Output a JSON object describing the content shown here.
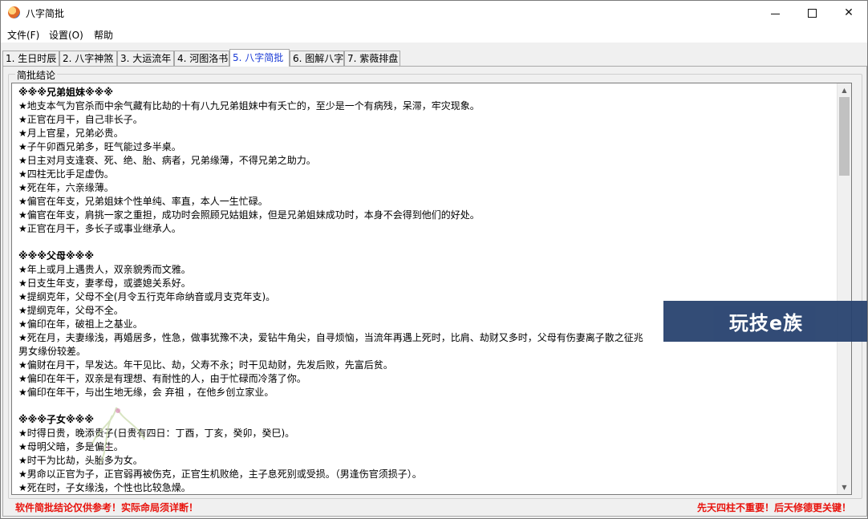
{
  "window": {
    "title": "八字简批"
  },
  "menu": [
    {
      "label": "文件(F)"
    },
    {
      "label": "设置(O)"
    },
    {
      "label": "帮助"
    }
  ],
  "tabs": [
    {
      "label": "1. 生日时辰"
    },
    {
      "label": "2. 八字神煞"
    },
    {
      "label": "3. 大运流年"
    },
    {
      "label": "4. 河图洛书"
    },
    {
      "label": "5. 八字简批",
      "active": true
    },
    {
      "label": "6. 图解八字"
    },
    {
      "label": "7. 紫薇排盘"
    }
  ],
  "group": {
    "label": "简批结论"
  },
  "content": {
    "lines": [
      "※※※兄弟姐妹※※※",
      "★地支本气为官杀而中余气藏有比劫的十有八九兄弟姐妹中有夭亡的，至少是一个有病残，呆滞，牢灾现象。",
      "★正官在月干，自己非长子。",
      "★月上官星，兄弟必贵。",
      "★子午卯酉兄弟多，旺气能过多半桌。",
      "★日主对月支逢衰、死、绝、胎、病者，兄弟缘薄，不得兄弟之助力。",
      "★四柱无比手足虚伪。",
      "★死在年，六亲缘薄。",
      "★偏官在年支，兄弟姐妹个性单纯、率直，本人一生忙碌。",
      "★偏官在年支，肩挑一家之重担，成功时会照顾兄姑姐妹，但是兄弟姐妹成功时，本身不会得到他们的好处。",
      "★正官在月干，多长子或事业继承人。",
      "",
      "※※※父母※※※",
      "★年上或月上遇贵人，双亲貌秀而文雅。",
      "★日支生年支，妻孝母，或婆媳关系好。",
      "★提纲克年，父母不全(月令五行克年命纳音或月支克年支)。",
      "★提纲克年，父母不全。",
      "★偏印在年，破祖上之基业。",
      "★死在月，夫妻缘浅，再婚居多，性急，做事犹豫不决，爱钻牛角尖，自寻烦恼，当流年再遇上死时，比肩、劫财又多时，父母有伤妻离子散之征兆",
      "男女缘份较差。",
      "★偏财在月干，早发达。年干见比、劫，父寿不永；时干见劫财，先发后败，先富后贫。",
      "★偏印在年干，双亲是有理想、有耐性的人，由于忙碌而冷落了你。",
      "★偏印在年干，与出生地无缘，会  弃祖  ，在他乡创立家业。",
      "",
      "※※※子女※※※",
      "★时得日贵，晚添贵子(日贵有四日：丁酉，丁亥，癸卯，癸巳)。",
      "★母明父暗，多是偏生。",
      "★时干为比劫，头胎多为女。",
      "★男命以正官为子，正官弱再被伤克，正官生机败绝，主子息死别或受损。（男逢伤官须损子）。",
      "★死在时，子女缘浅，个性也比较急燥。"
    ]
  },
  "watermark": {
    "text": "玩技e族"
  },
  "status": {
    "left": "软件简批结论仅供参考！实际命局须详断！",
    "right": "先天四柱不重要！后天修德更关键！"
  },
  "colors": {
    "status_text": "#e8130d",
    "active_tab_text": "#1a3bd6",
    "watermark_bg": "#28426f"
  }
}
